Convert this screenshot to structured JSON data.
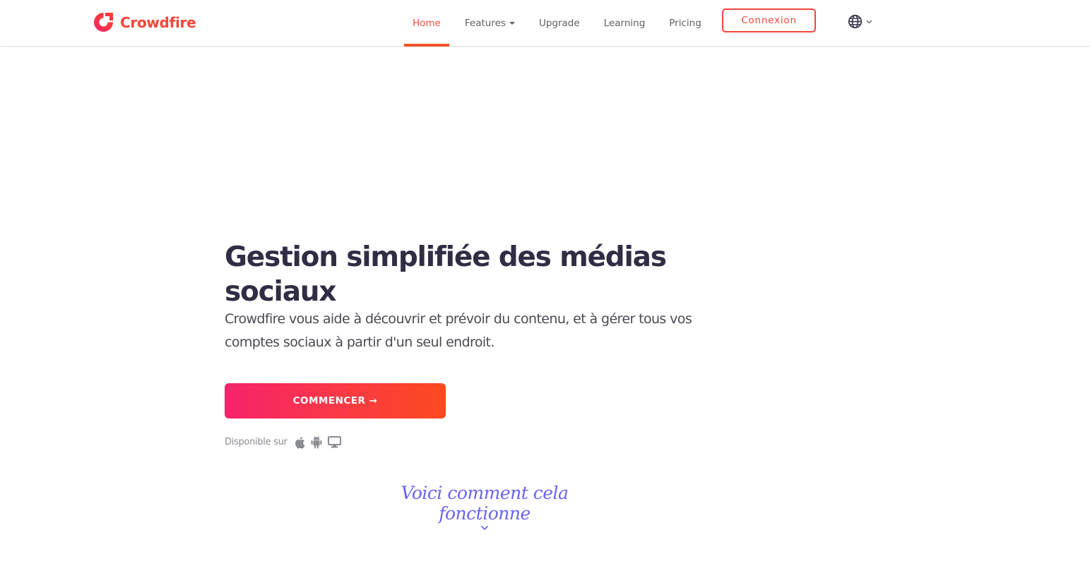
{
  "brand": {
    "name": "Crowdfire",
    "accent_color": "#f4463a",
    "logo_icon": "crowdfire-logo-icon"
  },
  "nav": {
    "items": [
      {
        "label": "Home",
        "active": true
      },
      {
        "label": "Features",
        "has_dropdown": true
      },
      {
        "label": "Upgrade"
      },
      {
        "label": "Learning"
      },
      {
        "label": "Pricing"
      }
    ],
    "login_label": "Connexion",
    "language_icon": "globe-icon"
  },
  "hero": {
    "title": "Gestion simplifiée des médias sociaux",
    "subtitle": "Crowdfire vous aide à découvrir et prévoir du contenu, et à gérer tous vos comptes sociaux à partir d'un seul endroit.",
    "cta_label": "COMMENCER →",
    "available_label": "Disponible sur",
    "platforms": [
      "apple-icon",
      "android-icon",
      "desktop-icon"
    ]
  },
  "how_it_works": {
    "label": "Voici comment cela fonctionne",
    "color": "#6a63f0"
  }
}
